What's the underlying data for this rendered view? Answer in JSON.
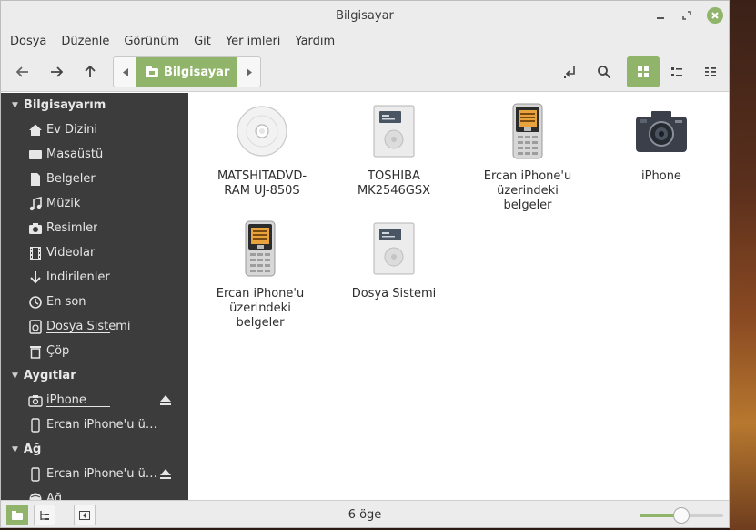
{
  "window": {
    "title": "Bilgisayar"
  },
  "menu": [
    "Dosya",
    "Düzenle",
    "Görünüm",
    "Git",
    "Yer imleri",
    "Yardım"
  ],
  "toolbar": {
    "location": "Bilgisayar"
  },
  "sidebar": {
    "sections": [
      {
        "title": "Bilgisayarım",
        "items": [
          {
            "label": "Ev Dizini",
            "icon": "home-icon"
          },
          {
            "label": "Masaüstü",
            "icon": "desktop-icon"
          },
          {
            "label": "Belgeler",
            "icon": "document-icon"
          },
          {
            "label": "Müzik",
            "icon": "music-icon"
          },
          {
            "label": "Resimler",
            "icon": "camera-icon"
          },
          {
            "label": "Videolar",
            "icon": "film-icon"
          },
          {
            "label": "İndirilenler",
            "icon": "download-icon"
          },
          {
            "label": "En son",
            "icon": "clock-icon"
          },
          {
            "label": "Dosya Sistemi",
            "icon": "filesystem-icon"
          },
          {
            "label": "Çöp",
            "icon": "trash-icon"
          }
        ]
      },
      {
        "title": "Aygıtlar",
        "items": [
          {
            "label": "iPhone",
            "icon": "camera-icon"
          },
          {
            "label": "Ercan iPhone'u ü…",
            "icon": "phone-icon"
          }
        ]
      },
      {
        "title": "Ağ",
        "items": [
          {
            "label": "Ercan iPhone'u ü…",
            "icon": "phone-icon"
          },
          {
            "label": "Ağ",
            "icon": "network-icon"
          }
        ]
      }
    ]
  },
  "content": {
    "items": [
      {
        "line1": "MATSHITADVD-",
        "line2": "RAM UJ-850S",
        "line3": "",
        "icon": "optical-disc-icon"
      },
      {
        "line1": "TOSHIBA",
        "line2": "MK2546GSX",
        "line3": "",
        "icon": "hard-drive-icon"
      },
      {
        "line1": "Ercan iPhone'u",
        "line2": "üzerindeki",
        "line3": "belgeler",
        "icon": "mobile-phone-icon"
      },
      {
        "line1": "iPhone",
        "line2": "",
        "line3": "",
        "icon": "camera-icon"
      },
      {
        "line1": "Ercan iPhone'u",
        "line2": "üzerindeki",
        "line3": "belgeler",
        "icon": "mobile-phone-icon"
      },
      {
        "line1": "Dosya Sistemi",
        "line2": "",
        "line3": "",
        "icon": "hard-drive-icon"
      }
    ]
  },
  "status": {
    "text": "6 öge",
    "zoom_fraction": 0.5
  },
  "colors": {
    "accent": "#8fb46a",
    "sidebar_bg": "#3c3c3c",
    "chrome_bg": "#ececec"
  }
}
